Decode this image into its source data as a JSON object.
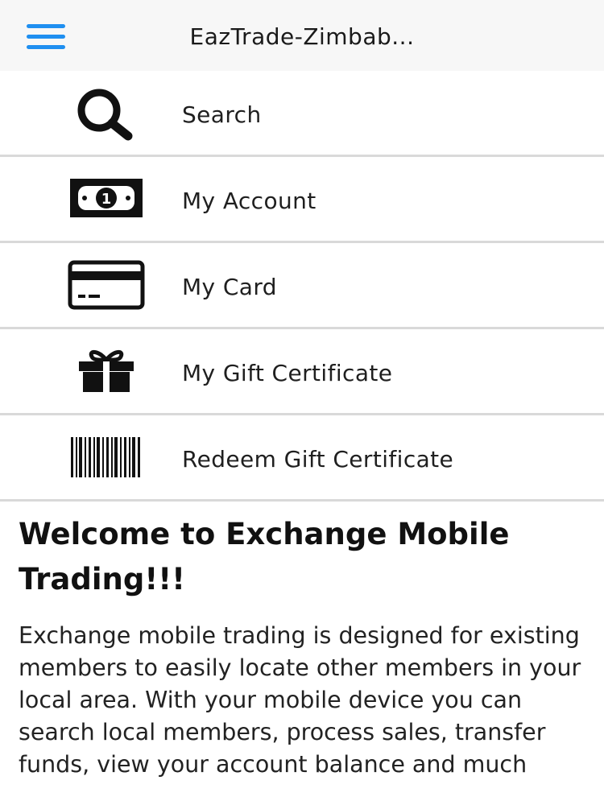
{
  "header": {
    "title": "EazTrade-Zimbab..."
  },
  "menu": {
    "items": [
      {
        "label": "Search",
        "icon": "search-icon"
      },
      {
        "label": "My Account",
        "icon": "money-bill-icon"
      },
      {
        "label": "My Card",
        "icon": "credit-card-icon"
      },
      {
        "label": "My Gift Certificate",
        "icon": "gift-icon"
      },
      {
        "label": "Redeem Gift Certificate",
        "icon": "barcode-icon"
      }
    ]
  },
  "main": {
    "welcome_title": "Welcome to Exchange Mobile Trading!!!",
    "intro_text": "Exchange mobile trading is designed for existing members to easily locate other members in your local area. With your mobile device you can search local members, process sales, transfer funds, view your account balance and much"
  },
  "colors": {
    "accent": "#1f8ff0",
    "divider": "#d9d9d9",
    "header_bg": "#f7f7f7"
  }
}
